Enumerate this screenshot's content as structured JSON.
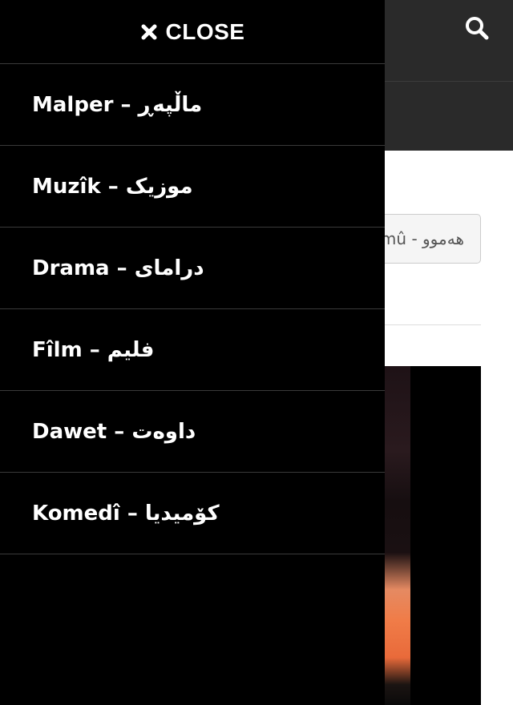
{
  "menu": {
    "close_label": "CLOSE",
    "close_icon": "close-icon",
    "items": [
      {
        "label": "Malper – ماڵپەڕ"
      },
      {
        "label": "Muzîk – موزیک"
      },
      {
        "label": "Drama – درامای"
      },
      {
        "label": "Fîlm – فلیم"
      },
      {
        "label": "Dawet – داوەت"
      },
      {
        "label": "Komedî – کۆمیدیا"
      }
    ]
  },
  "header": {
    "search_icon": "search-icon"
  },
  "filter": {
    "selected_value": "mû - هەموو"
  },
  "colors": {
    "drawer_bg": "#000000",
    "header_bg": "#2a2a2a",
    "text": "#ffffff",
    "divider": "#3a3a3a"
  }
}
